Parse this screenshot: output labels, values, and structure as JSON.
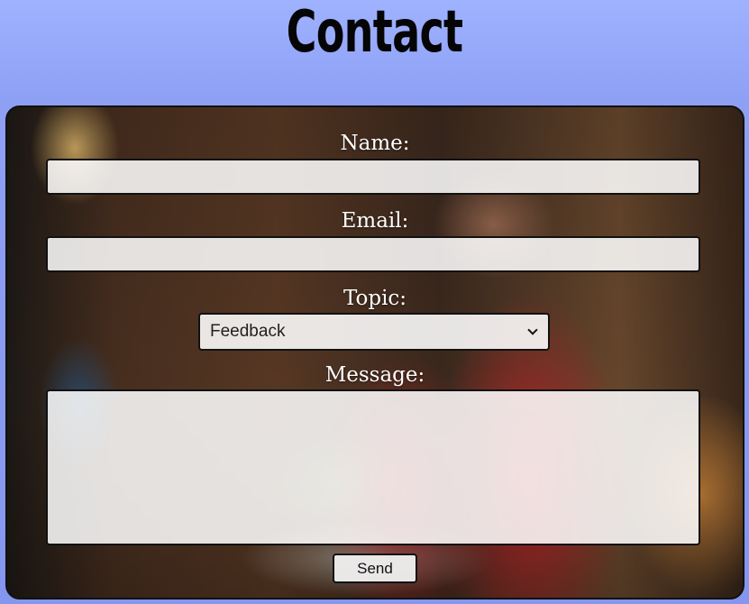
{
  "header": {
    "title": "Contact"
  },
  "form": {
    "name_label": "Name:",
    "name_value": "",
    "email_label": "Email:",
    "email_value": "",
    "topic_label": "Topic:",
    "topic_selected": "Feedback",
    "message_label": "Message:",
    "message_value": "",
    "send_label": "Send"
  },
  "colors": {
    "page_background": "#9fb2ff",
    "panel_border": "#111111",
    "label_text": "#ffffff"
  }
}
